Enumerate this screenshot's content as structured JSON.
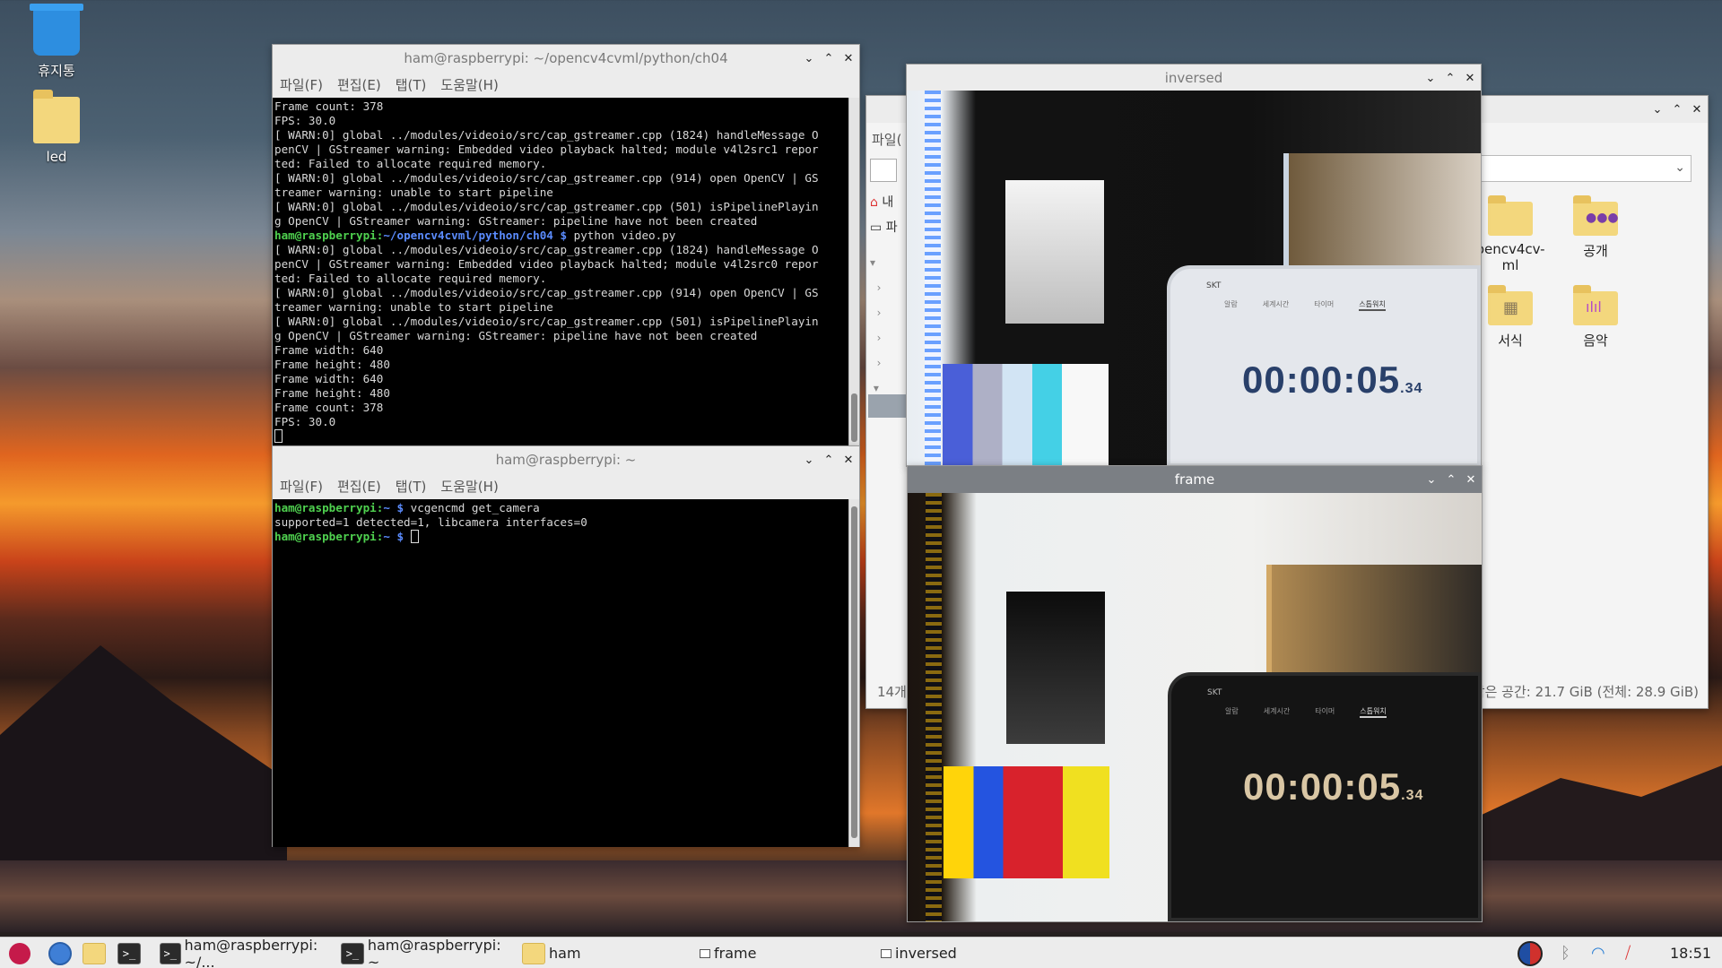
{
  "desktop": {
    "icons": [
      {
        "label": "휴지통"
      },
      {
        "label": "led"
      }
    ]
  },
  "terminal1": {
    "title": "ham@raspberrypi: ~/opencv4cvml/python/ch04",
    "menu": [
      "파일(F)",
      "편집(E)",
      "탭(T)",
      "도움말(H)"
    ],
    "lines": [
      {
        "text": "Frame count: 378"
      },
      {
        "text": "FPS: 30.0"
      },
      {
        "text": "[ WARN:0] global ../modules/videoio/src/cap_gstreamer.cpp (1824) handleMessage O"
      },
      {
        "text": "penCV | GStreamer warning: Embedded video playback halted; module v4l2src1 repor"
      },
      {
        "text": "ted: Failed to allocate required memory."
      },
      {
        "text": "[ WARN:0] global ../modules/videoio/src/cap_gstreamer.cpp (914) open OpenCV | GS"
      },
      {
        "text": "treamer warning: unable to start pipeline"
      },
      {
        "text": "[ WARN:0] global ../modules/videoio/src/cap_gstreamer.cpp (501) isPipelinePlayin"
      },
      {
        "text": "g OpenCV | GStreamer warning: GStreamer: pipeline have not been created"
      },
      {
        "prompt_user": "ham@raspberrypi",
        "prompt_path": "~/opencv4cvml/python/ch04 $",
        "cmd": " python video.py"
      },
      {
        "text": "[ WARN:0] global ../modules/videoio/src/cap_gstreamer.cpp (1824) handleMessage O"
      },
      {
        "text": "penCV | GStreamer warning: Embedded video playback halted; module v4l2src0 repor"
      },
      {
        "text": "ted: Failed to allocate required memory."
      },
      {
        "text": "[ WARN:0] global ../modules/videoio/src/cap_gstreamer.cpp (914) open OpenCV | GS"
      },
      {
        "text": "treamer warning: unable to start pipeline"
      },
      {
        "text": "[ WARN:0] global ../modules/videoio/src/cap_gstreamer.cpp (501) isPipelinePlayin"
      },
      {
        "text": "g OpenCV | GStreamer warning: GStreamer: pipeline have not been created"
      },
      {
        "text": "Frame width: 640"
      },
      {
        "text": "Frame height: 480"
      },
      {
        "text": "Frame width: 640"
      },
      {
        "text": "Frame height: 480"
      },
      {
        "text": "Frame count: 378"
      },
      {
        "text": "FPS: 30.0"
      }
    ]
  },
  "terminal2": {
    "title": "ham@raspberrypi: ~",
    "menu": [
      "파일(F)",
      "편집(E)",
      "탭(T)",
      "도움말(H)"
    ],
    "lines": [
      {
        "prompt_user": "ham@raspberrypi",
        "prompt_path": "~ $",
        "cmd": " vcgencmd get_camera"
      },
      {
        "text": "supported=1 detected=1, libcamera interfaces=0"
      },
      {
        "prompt_user": "ham@raspberrypi",
        "prompt_path": "~ $",
        "cmd": " "
      }
    ]
  },
  "inversed_window": {
    "title": "inversed",
    "stopwatch_main": "00:00:05",
    "stopwatch_ms": ".34",
    "phone_tabs": [
      "알람",
      "세계시간",
      "타이머",
      "스톱워치"
    ],
    "carrier": "SKT"
  },
  "frame_window": {
    "title": "frame",
    "stopwatch_main": "00:00:05",
    "stopwatch_ms": ".34",
    "phone_tabs": [
      "알람",
      "세계시간",
      "타이머",
      "스톱워치"
    ],
    "carrier": "SKT"
  },
  "file_manager": {
    "menu_partial": "파일(",
    "sidebar_partial": [
      "내",
      "파"
    ],
    "items": [
      {
        "label": "pencv4cv-\nml",
        "label_line1": "pencv4cv-",
        "label_line2": "ml",
        "icon": "folder-icon"
      },
      {
        "label": "공개",
        "icon": "public-folder-icon"
      },
      {
        "label": "서식",
        "icon": "templates-folder-icon"
      },
      {
        "label": "음악",
        "icon": "music-folder-icon"
      }
    ],
    "status_left": "14개",
    "status_right": "남은 공간: 21.7 GiB (전체: 28.9 GiB)"
  },
  "taskbar": {
    "tasks": [
      {
        "label": "ham@raspberrypi: ~/...",
        "icon": "terminal-icon"
      },
      {
        "label": "ham@raspberrypi: ~",
        "icon": "terminal-icon"
      },
      {
        "label": "ham",
        "icon": "folder-icon"
      },
      {
        "label": "frame",
        "icon": "window-icon"
      },
      {
        "label": "inversed",
        "icon": "window-icon"
      }
    ],
    "clock": "18:51"
  }
}
